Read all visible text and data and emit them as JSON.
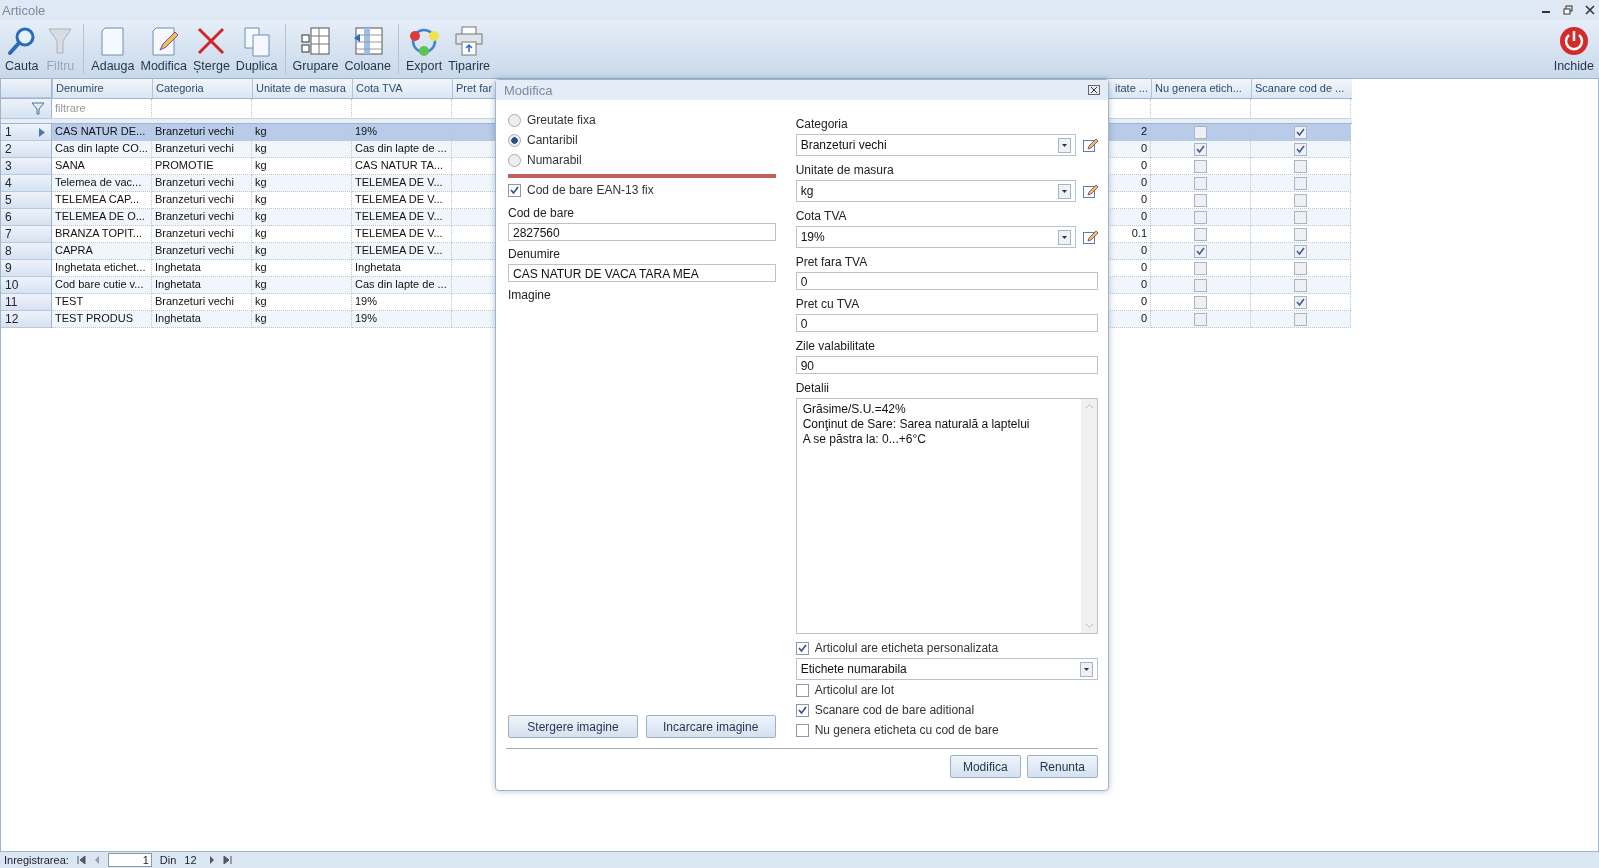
{
  "window": {
    "title": "Articole"
  },
  "toolbar_groups": [
    {
      "items": [
        {
          "kind": "search",
          "label": "Cauta",
          "disabled": false
        },
        {
          "kind": "filter",
          "label": "Filtru",
          "disabled": true
        }
      ]
    },
    {
      "items": [
        {
          "kind": "new",
          "label": "Adauga",
          "disabled": false
        },
        {
          "kind": "edit",
          "label": "Modifica",
          "disabled": false
        },
        {
          "kind": "delete",
          "label": "Șterge",
          "disabled": false
        },
        {
          "kind": "copy",
          "label": "Duplica",
          "disabled": false
        }
      ]
    },
    {
      "items": [
        {
          "kind": "group",
          "label": "Grupare",
          "disabled": false
        },
        {
          "kind": "columns",
          "label": "Coloane",
          "disabled": false
        }
      ]
    },
    {
      "items": [
        {
          "kind": "export",
          "label": "Export",
          "disabled": false
        },
        {
          "kind": "print",
          "label": "Tiparire",
          "disabled": false
        }
      ]
    }
  ],
  "close_button": {
    "label": "Inchide"
  },
  "table": {
    "columns": [
      {
        "label": "Denumire"
      },
      {
        "label": "Categoria"
      },
      {
        "label": "Unitate de masura"
      },
      {
        "label": "Cota TVA"
      },
      {
        "label": "Pret far"
      },
      {
        "label": "itate ..."
      },
      {
        "label": "Nu genera etich..."
      },
      {
        "label": "Scanare cod de ..."
      }
    ],
    "filter_placeholder": "filtrare",
    "rows": [
      {
        "number": "1",
        "name": "CAS NATUR DE...",
        "category": "Branzeturi vechi",
        "unit": "kg",
        "tva": "19%",
        "column_6": "2",
        "no_label": false,
        "scan": true,
        "selected": true
      },
      {
        "number": "2",
        "name": "Cas din lapte CO...",
        "category": "Branzeturi vechi",
        "unit": "kg",
        "tva": "Cas din lapte de ...",
        "column_6": "0",
        "no_label": true,
        "scan": true,
        "selected": false
      },
      {
        "number": "3",
        "name": "SANA",
        "category": "PROMOTIE",
        "unit": "kg",
        "tva": "CAS NATUR TA...",
        "column_6": "0",
        "no_label": false,
        "scan": false,
        "selected": false
      },
      {
        "number": "4",
        "name": "Telemea de vac...",
        "category": "Branzeturi vechi",
        "unit": "kg",
        "tva": "TELEMEA DE V...",
        "column_6": "0",
        "no_label": false,
        "scan": false,
        "selected": false
      },
      {
        "number": "5",
        "name": "TELEMEA CAP...",
        "category": "Branzeturi vechi",
        "unit": "kg",
        "tva": "TELEMEA DE V...",
        "column_6": "0",
        "no_label": false,
        "scan": false,
        "selected": false
      },
      {
        "number": "6",
        "name": "TELEMEA DE O...",
        "category": "Branzeturi vechi",
        "unit": "kg",
        "tva": "TELEMEA DE V...",
        "column_6": "0",
        "no_label": false,
        "scan": false,
        "selected": false
      },
      {
        "number": "7",
        "name": "BRANZA TOPIT...",
        "category": "Branzeturi vechi",
        "unit": "kg",
        "tva": "TELEMEA DE V...",
        "column_6": "0.1",
        "no_label": false,
        "scan": false,
        "selected": false
      },
      {
        "number": "8",
        "name": "CAPRA",
        "category": "Branzeturi vechi",
        "unit": "kg",
        "tva": "TELEMEA DE V...",
        "column_6": "0",
        "no_label": true,
        "scan": true,
        "selected": false
      },
      {
        "number": "9",
        "name": "Inghetata etichet...",
        "category": "Inghetata",
        "unit": "kg",
        "tva": "Inghetata",
        "column_6": "0",
        "no_label": false,
        "scan": false,
        "selected": false
      },
      {
        "number": "10",
        "name": "Cod bare cutie v...",
        "category": "Inghetata",
        "unit": "kg",
        "tva": "Cas din lapte de ...",
        "column_6": "0",
        "no_label": false,
        "scan": false,
        "selected": false
      },
      {
        "number": "11",
        "name": "TEST",
        "category": "Branzeturi vechi",
        "unit": "kg",
        "tva": "19%",
        "column_6": "0",
        "no_label": false,
        "scan": true,
        "selected": false
      },
      {
        "number": "12",
        "name": "TEST PRODUS",
        "category": "Inghetata",
        "unit": "kg",
        "tva": "19%",
        "column_6": "0",
        "no_label": false,
        "scan": false,
        "selected": false
      }
    ]
  },
  "dialog": {
    "title": "Modifica",
    "type_options": [
      {
        "label": "Greutate fixa",
        "selected": false
      },
      {
        "label": "Cantaribil",
        "selected": true
      },
      {
        "label": "Numarabil",
        "selected": false
      }
    ],
    "ean_checkbox": {
      "label": "Cod de bare EAN-13 fix",
      "checked": true
    },
    "left_fields": [
      {
        "label": "Cod de bare",
        "value": "2827560"
      },
      {
        "label": "Denumire",
        "value": "CAS NATUR DE VACA TARA MEA"
      }
    ],
    "image_label": "Imagine",
    "image_buttons": [
      "Stergere imagine",
      "Incarcare imagine"
    ],
    "combos": [
      {
        "label": "Categoria",
        "value": "Branzeturi vechi"
      },
      {
        "label": "Unitate de masura",
        "value": "kg"
      },
      {
        "label": "Cota TVA",
        "value": "19%"
      }
    ],
    "text_fields": [
      {
        "label": "Pret fara TVA",
        "value": "0"
      },
      {
        "label": "Pret cu TVA",
        "value": "0"
      },
      {
        "label": "Zile valabilitate",
        "value": "90"
      }
    ],
    "details": {
      "label": "Detalii",
      "value": "Grăsime/S.U.=42%\nConţinut de Sare: Sarea naturală a laptelui\nA se păstra la: 0...+6°C"
    },
    "options": [
      {
        "kind": "checkbox",
        "label": "Articolul are eticheta personalizata",
        "checked": true
      },
      {
        "kind": "dropdown",
        "value": "Etichete numarabila"
      },
      {
        "kind": "checkbox",
        "label": "Articolul are lot",
        "checked": false
      },
      {
        "kind": "checkbox",
        "label": "Scanare cod de bare aditional",
        "checked": true
      },
      {
        "kind": "checkbox",
        "label": "Nu genera eticheta cu cod de bare",
        "checked": false
      }
    ],
    "buttons": [
      "Modifica",
      "Renunta"
    ]
  },
  "status_bar": {
    "label": "Inregistrarea:",
    "current": "1",
    "of": "Din",
    "total": "12"
  }
}
